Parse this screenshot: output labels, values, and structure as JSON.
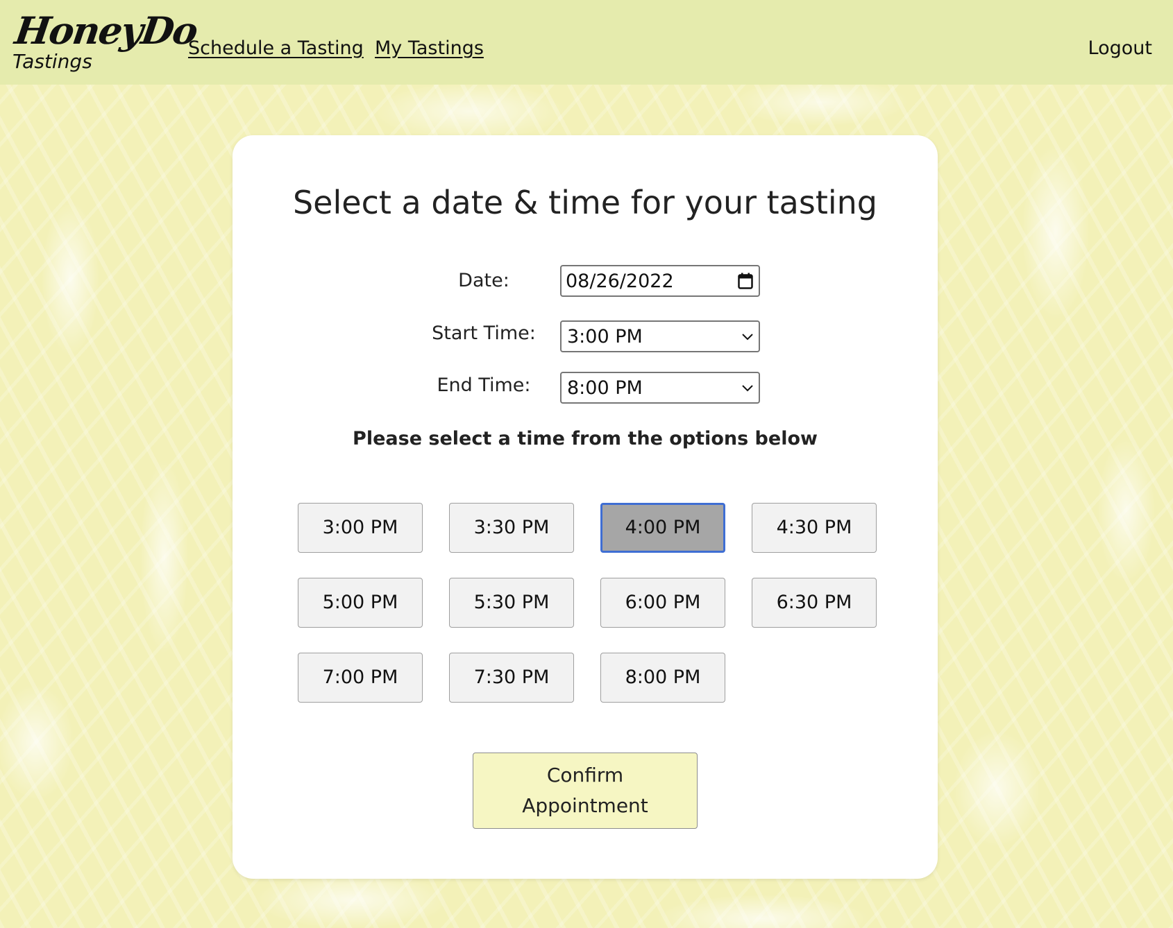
{
  "header": {
    "brand_main": "HoneyDo",
    "brand_sub": "Tastings",
    "nav": {
      "schedule_label": "Schedule a Tasting",
      "my_tastings_label": "My Tastings"
    },
    "logout_label": "Logout",
    "background_color": "#e5ebad"
  },
  "card": {
    "title": "Select a date & time for your tasting",
    "form": {
      "date_label": "Date:",
      "date_value": "08/26/2022",
      "start_label": "Start Time:",
      "start_value": "3:00 PM",
      "end_label": "End Time:",
      "end_value": "8:00 PM"
    },
    "instruction": "Please select a time from the options below",
    "slots": [
      {
        "label": "3:00 PM",
        "selected": false
      },
      {
        "label": "3:30 PM",
        "selected": false
      },
      {
        "label": "4:00 PM",
        "selected": true
      },
      {
        "label": "4:30 PM",
        "selected": false
      },
      {
        "label": "5:00 PM",
        "selected": false
      },
      {
        "label": "5:30 PM",
        "selected": false
      },
      {
        "label": "6:00 PM",
        "selected": false
      },
      {
        "label": "6:30 PM",
        "selected": false
      },
      {
        "label": "7:00 PM",
        "selected": false
      },
      {
        "label": "7:30 PM",
        "selected": false
      },
      {
        "label": "8:00 PM",
        "selected": false
      }
    ],
    "confirm_line1": "Confirm",
    "confirm_line2": "Appointment"
  },
  "colors": {
    "selected_slot_bg": "#a6a6a6",
    "selected_slot_border": "#3f6ed3",
    "confirm_bg": "#f6f6c3",
    "page_background": "#f3f1b8"
  },
  "icons": {
    "date_picker": "calendar-icon",
    "select_arrow": "chevron-down-icon"
  }
}
